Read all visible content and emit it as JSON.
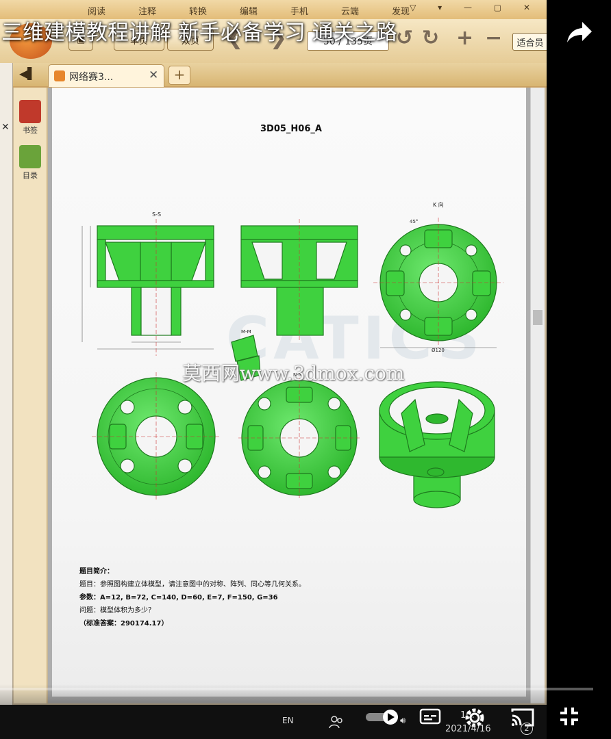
{
  "video": {
    "title": "三维建模教程讲解 新手必备学习 通关之路"
  },
  "menu": {
    "items": [
      "阅读",
      "注释",
      "转换",
      "编辑",
      "手机",
      "云端",
      "发现"
    ]
  },
  "toolbar": {
    "single_page": "单页",
    "double_page": "双页",
    "page_indicator": "50 / 135页",
    "fit": "适合员"
  },
  "tabs": {
    "doc_tab_label": "网络赛3..."
  },
  "sidebar": {
    "bookmark_label": "书签",
    "toc_label": "目录"
  },
  "document": {
    "drawing_id": "3D05_H06_A",
    "view_labels": {
      "section_ss": "S-S",
      "view_k": "K 向",
      "section_mm": "M-M",
      "section_nn": "N-N",
      "dim_d120": "Ø120",
      "dim_angle": "45°"
    },
    "watermark_logo": "CATICS",
    "watermark_url": "莫西网www.3dmox.com",
    "description": {
      "heading": "题目简介：",
      "task": "题目：参照图构建立体模型，请注意图中的对称、阵列、同心等几何关系。",
      "params": "参数：A=12, B=72, C=140, D=60, E=7, F=150, G=36",
      "question": "问题：模型体积为多少？",
      "answer": "（标准答案：290174.17）"
    }
  },
  "taskbar": {
    "lang": "EN",
    "time": "10:",
    "date": "2021/4/16",
    "badge_count": "2"
  },
  "colors": {
    "part_green": "#3fd13f",
    "part_outline": "#1e7a1e",
    "toolbar_bg": "#e6cc97"
  }
}
